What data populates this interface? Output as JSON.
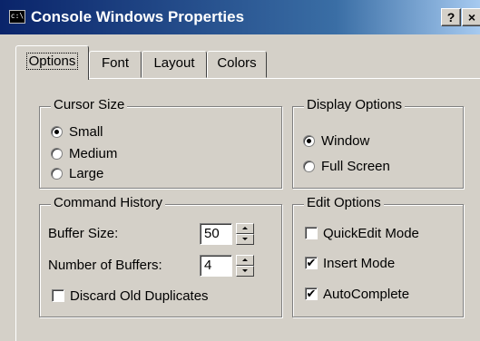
{
  "window": {
    "title": "Console Windows Properties",
    "app_icon_label": "c:\\",
    "help_label": "?",
    "close_label": "×"
  },
  "tabs": [
    {
      "label": "Options",
      "active": true
    },
    {
      "label": "Font",
      "active": false
    },
    {
      "label": "Layout",
      "active": false
    },
    {
      "label": "Colors",
      "active": false
    }
  ],
  "cursor_size": {
    "title": "Cursor Size",
    "options": [
      {
        "label": "Small",
        "selected": true
      },
      {
        "label": "Medium",
        "selected": false
      },
      {
        "label": "Large",
        "selected": false
      }
    ]
  },
  "display_options": {
    "title": "Display Options",
    "options": [
      {
        "label": "Window",
        "selected": true
      },
      {
        "label": "Full Screen",
        "selected": false
      }
    ]
  },
  "command_history": {
    "title": "Command History",
    "buffer_size_label": "Buffer Size:",
    "buffer_size_value": "50",
    "number_of_buffers_label": "Number of Buffers:",
    "number_of_buffers_value": "4",
    "discard_label": "Discard Old Duplicates",
    "discard_checked": false
  },
  "edit_options": {
    "title": "Edit Options",
    "options": [
      {
        "label": "QuickEdit Mode",
        "checked": false
      },
      {
        "label": "Insert Mode",
        "checked": true
      },
      {
        "label": "AutoComplete",
        "checked": true
      }
    ]
  },
  "check_mark": "✔"
}
